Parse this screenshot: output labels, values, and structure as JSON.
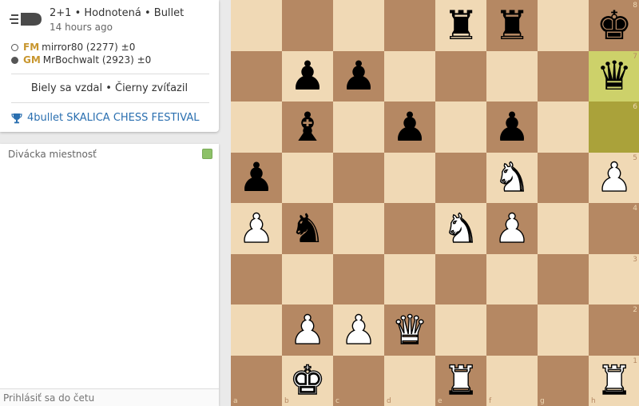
{
  "game": {
    "type": "2+1 • Hodnotená • Bullet",
    "time_ago": "14 hours ago",
    "white_player": {
      "title": "FM",
      "name": "mirror80 (2277) ±0"
    },
    "black_player": {
      "title": "GM",
      "name": "MrBochwalt (2923) ±0"
    },
    "result": "Biely sa vzdal • Čierny zvíťazil",
    "tournament": "4bullet SKALICA CHESS FESTIVAL"
  },
  "chat": {
    "title": "Divácka miestnosť",
    "placeholder": "Prihlásiť sa do četu"
  },
  "board": {
    "ranks": [
      "8",
      "7",
      "6",
      "5",
      "4",
      "3",
      "2",
      "1"
    ],
    "files": [
      "a",
      "b",
      "c",
      "d",
      "e",
      "f",
      "g",
      "h"
    ],
    "highlighted": [
      "h7",
      "h6"
    ],
    "pieces": {
      "e8": "bR",
      "f8": "bR",
      "h8": "bK",
      "b7": "bP",
      "c7": "bP",
      "h7": "bQ",
      "b6": "bB",
      "d6": "bP",
      "f6": "bP",
      "a5": "bP",
      "f5": "wN",
      "h5": "wP",
      "a4": "wP",
      "b4": "bN",
      "e4": "wN",
      "f4": "wP",
      "b2": "wP",
      "c2": "wP",
      "d2": "wQ",
      "b1": "wK",
      "e1": "wR",
      "h1": "wR"
    }
  }
}
